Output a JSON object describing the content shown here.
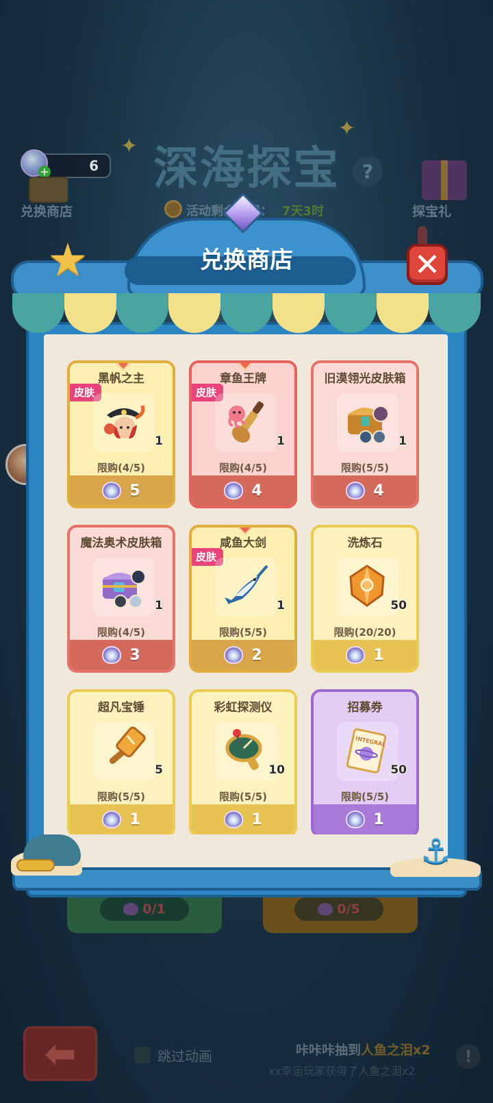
{
  "background": {
    "event_title": "深海探宝",
    "help_glyph": "?",
    "currency_value": "6",
    "exchange_shop_label": "兑换商店",
    "timer_label": "活动剩余时间：",
    "timer_value": "7天3时",
    "gift_label": "探宝礼",
    "left_progress": "0/1",
    "right_progress": "0/5",
    "skip_label": "跳过动画",
    "ticker_prefix": "咔咔咔抽到",
    "ticker_highlight": "人鱼之泪x2",
    "ticker_line2": "xx幸运玩家获得了人鱼之泪x2",
    "back_glyph": "⬅",
    "alert_glyph": "!"
  },
  "modal": {
    "title": "兑换商店",
    "close_glyph": "✕",
    "colors": {
      "frame": "#2c86c4",
      "inner": "#efe8db",
      "close": "#e0453c"
    }
  },
  "skin_badge_label": "皮肤",
  "items": [
    {
      "name": "黑帆之主",
      "qty": "1",
      "limit": "限购(4/5)",
      "price": "5",
      "style": "gold",
      "skin": true,
      "icon": "pirate-captain-icon"
    },
    {
      "name": "章鱼王牌",
      "qty": "1",
      "limit": "限购(4/5)",
      "price": "4",
      "style": "red",
      "skin": true,
      "icon": "octopus-guitar-icon"
    },
    {
      "name": "旧漠翎光皮肤箱",
      "qty": "1",
      "limit": "限购(5/5)",
      "price": "4",
      "style": "pink",
      "skin": false,
      "icon": "skin-chest-icon"
    },
    {
      "name": "魔法奥术皮肤箱",
      "qty": "1",
      "limit": "限购(4/5)",
      "price": "3",
      "style": "pink",
      "skin": false,
      "icon": "magic-chest-icon"
    },
    {
      "name": "咸鱼大剑",
      "qty": "1",
      "limit": "限购(5/5)",
      "price": "2",
      "style": "gold",
      "skin": true,
      "icon": "swordfish-icon"
    },
    {
      "name": "洗炼石",
      "qty": "50",
      "limit": "限购(20/20)",
      "price": "1",
      "style": "yellow",
      "skin": false,
      "icon": "refine-stone-icon"
    },
    {
      "name": "超凡宝锤",
      "qty": "5",
      "limit": "限购(5/5)",
      "price": "1",
      "style": "yellow",
      "skin": false,
      "icon": "hammer-icon"
    },
    {
      "name": "彩虹探测仪",
      "qty": "10",
      "limit": "限购(5/5)",
      "price": "1",
      "style": "yellow",
      "skin": false,
      "icon": "detector-icon"
    },
    {
      "name": "招募券",
      "qty": "50",
      "limit": "限购(5/5)",
      "price": "1",
      "style": "purple",
      "skin": false,
      "icon": "recruit-ticket-icon"
    }
  ],
  "ticket_text": "INTEGRAL"
}
